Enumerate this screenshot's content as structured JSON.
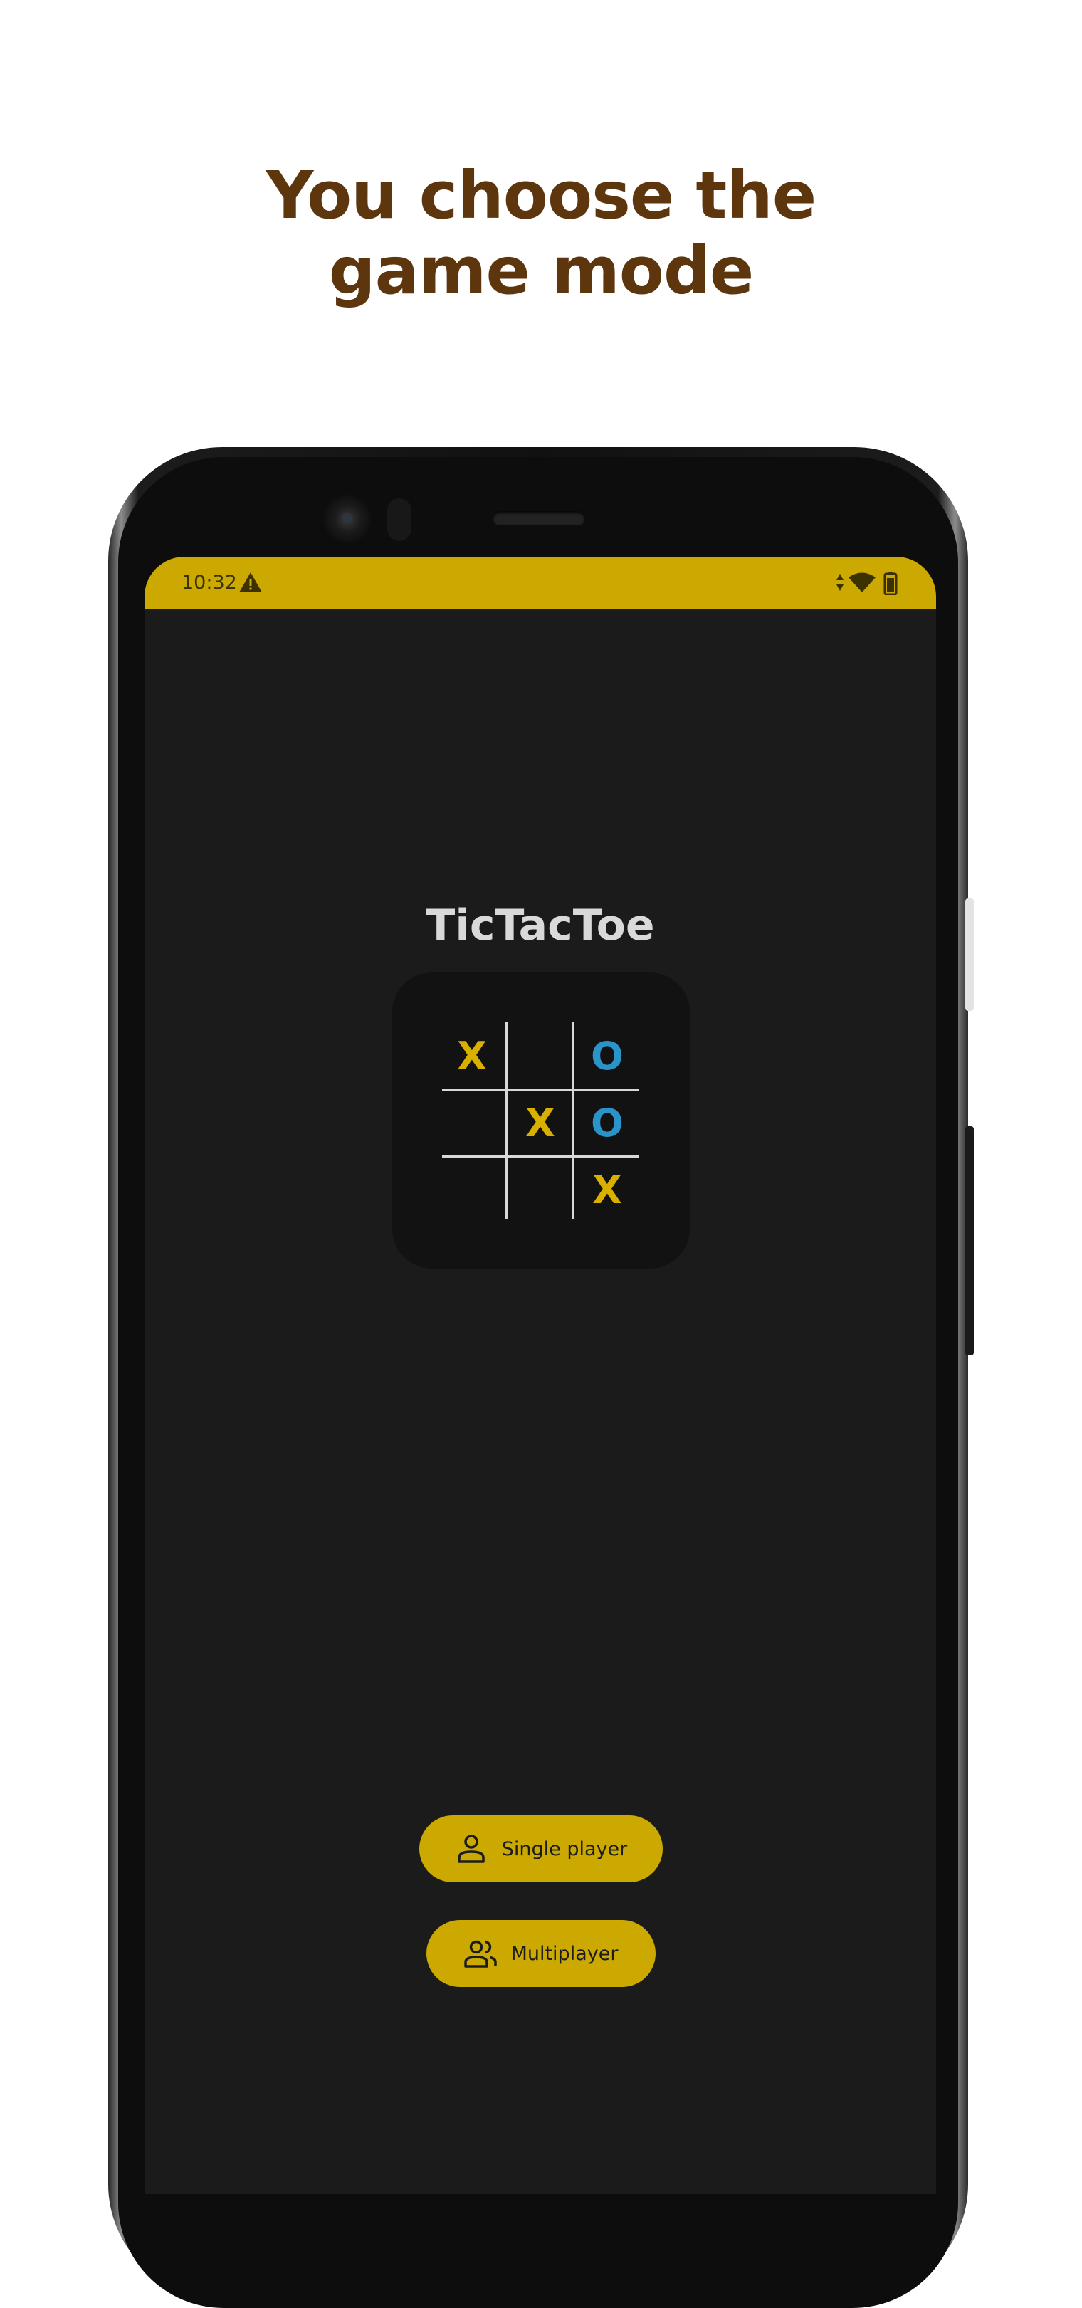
{
  "headline": {
    "line1": "You choose the",
    "line2": "game mode"
  },
  "colors": {
    "accent": "#cba900",
    "headline": "#5e360d",
    "screen_bg": "#1b1b1b",
    "mark_x": "#d9b000",
    "mark_o": "#2a93c8"
  },
  "status_bar": {
    "time": "10:32",
    "icons": [
      "warning-icon",
      "data-signal-icon",
      "wifi-icon",
      "battery-icon"
    ]
  },
  "app": {
    "title": "TicTacToe",
    "board": [
      [
        "X",
        "",
        "O"
      ],
      [
        "",
        "X",
        "O"
      ],
      [
        "",
        "",
        "X"
      ]
    ],
    "buttons": {
      "single": {
        "label": "Single player",
        "icon": "person-icon"
      },
      "multi": {
        "label": "Multiplayer",
        "icon": "people-icon"
      }
    }
  }
}
